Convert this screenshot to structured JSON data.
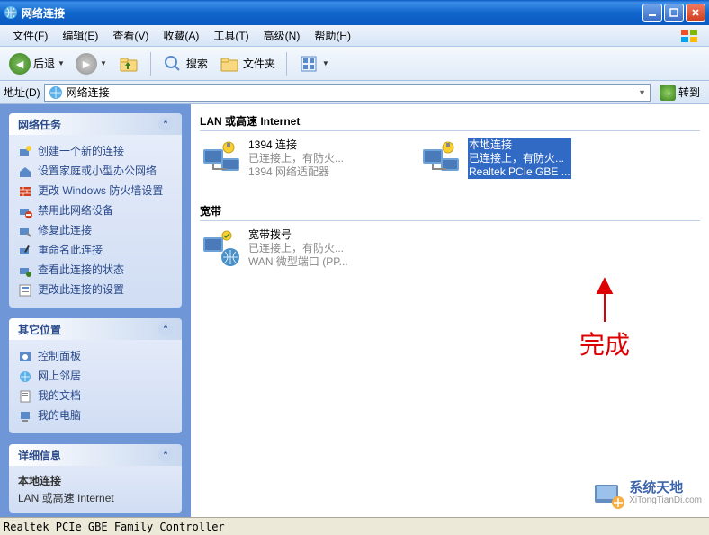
{
  "window": {
    "title": "网络连接",
    "minimize": "_",
    "maximize": "□",
    "close": "✕"
  },
  "menu": {
    "file": "文件(F)",
    "edit": "编辑(E)",
    "view": "查看(V)",
    "favorites": "收藏(A)",
    "tools": "工具(T)",
    "advanced": "高级(N)",
    "help": "帮助(H)"
  },
  "toolbar": {
    "back": "后退",
    "search": "搜索",
    "folders": "文件夹"
  },
  "addressbar": {
    "label": "地址(D)",
    "value": "网络连接",
    "go": "转到"
  },
  "sidebar": {
    "tasks": {
      "title": "网络任务",
      "items": [
        "创建一个新的连接",
        "设置家庭或小型办公网络",
        "更改 Windows 防火墙设置",
        "禁用此网络设备",
        "修复此连接",
        "重命名此连接",
        "查看此连接的状态",
        "更改此连接的设置"
      ]
    },
    "other": {
      "title": "其它位置",
      "items": [
        "控制面板",
        "网上邻居",
        "我的文档",
        "我的电脑"
      ]
    },
    "details": {
      "title": "详细信息",
      "name": "本地连接",
      "type": "LAN 或高速 Internet"
    }
  },
  "main": {
    "groups": [
      {
        "header": "LAN 或高速 Internet",
        "items": [
          {
            "name": "1394 连接",
            "status": "已连接上，有防火...",
            "device": "1394 网络适配器",
            "selected": false
          },
          {
            "name": "本地连接",
            "status": "已连接上，有防火...",
            "device": "Realtek PCIe GBE ...",
            "selected": true
          }
        ]
      },
      {
        "header": "宽带",
        "items": [
          {
            "name": "宽带拨号",
            "status": "已连接上，有防火...",
            "device": "WAN 微型端口 (PP...",
            "selected": false
          }
        ]
      }
    ]
  },
  "annotation": "完成",
  "statusbar": "Realtek PCIe GBE Family Controller",
  "watermark": {
    "line1": "系统天地",
    "line2": "XiTongTianDi.com"
  }
}
